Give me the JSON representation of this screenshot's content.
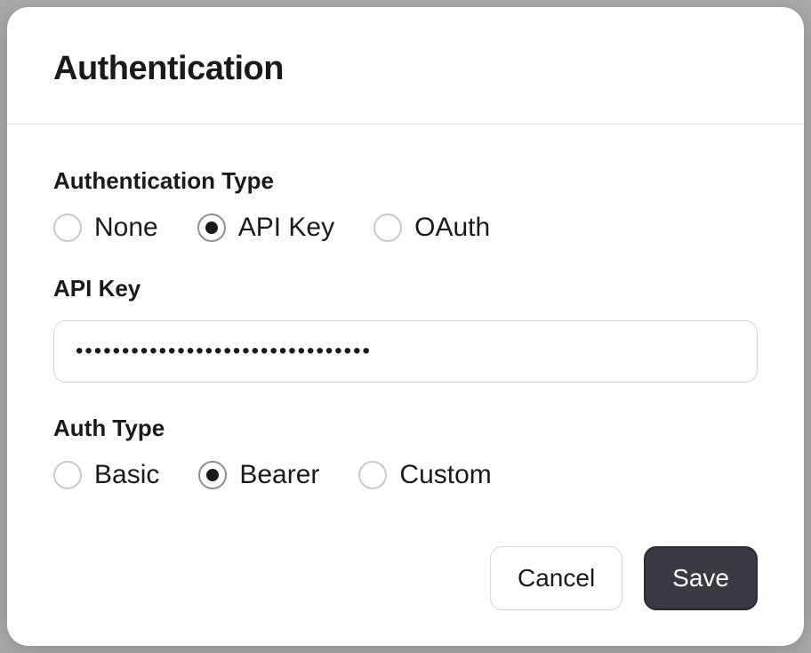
{
  "modal": {
    "title": "Authentication",
    "authentication_type": {
      "label": "Authentication Type",
      "options": [
        {
          "label": "None",
          "selected": false
        },
        {
          "label": "API Key",
          "selected": true
        },
        {
          "label": "OAuth",
          "selected": false
        }
      ]
    },
    "api_key": {
      "label": "API Key",
      "value": "••••••••••••••••••••••••••••••••"
    },
    "auth_type": {
      "label": "Auth Type",
      "options": [
        {
          "label": "Basic",
          "selected": false
        },
        {
          "label": "Bearer",
          "selected": true
        },
        {
          "label": "Custom",
          "selected": false
        }
      ]
    },
    "footer": {
      "cancel": "Cancel",
      "save": "Save"
    }
  }
}
